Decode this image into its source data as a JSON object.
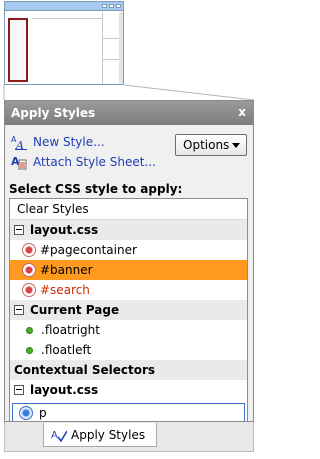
{
  "panel": {
    "title": "Apply Styles",
    "close_label": "x",
    "new_style_label": "New Style...",
    "attach_label": "Attach Style Sheet...",
    "options_label": "Options",
    "select_label": "Select CSS style to apply:"
  },
  "list": {
    "clear_label": "Clear Styles",
    "groups": [
      {
        "name": "layout.css",
        "rules": [
          "#pagecontainer",
          "#banner",
          "#search"
        ]
      },
      {
        "name": "Current Page",
        "rules": [
          ".floatright",
          ".floatleft"
        ]
      },
      {
        "name": "Contextual Selectors"
      },
      {
        "name": "layout.css",
        "rules": [
          "p"
        ]
      }
    ]
  },
  "tab": {
    "label": "Apply Styles"
  },
  "colors": {
    "selection": "#ff9a1f",
    "link": "#1f3fb0",
    "title_bar": "#8c8c8c"
  },
  "icons": [
    "new-style-icon",
    "attach-style-sheet-icon",
    "chevron-down-icon",
    "collapse-icon",
    "id-style-icon",
    "class-style-icon",
    "element-style-icon",
    "apply-styles-icon"
  ]
}
